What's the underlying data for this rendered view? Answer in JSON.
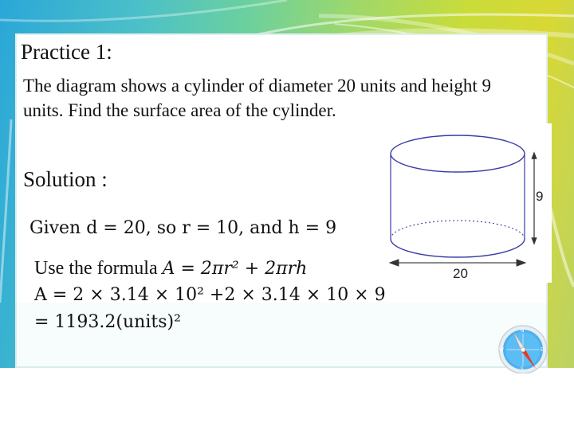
{
  "slide": {
    "title": "Practice 1:",
    "problem": "The diagram shows a cylinder of diameter 20 units and height 9 units. Find the surface area of the cylinder.",
    "solution_label": "Solution :",
    "steps": {
      "given": "Given d = 20, so r = 10, and h = 9",
      "formula_label": "Use the formula ",
      "formula": "A = 2πr² + 2πrh",
      "substitution": "A = 2 × 3.14 × 10² +2 × 3.14 × 10 × 9",
      "result": "= 1193.2(units)²"
    }
  },
  "diagram": {
    "shape": "cylinder",
    "height_label": "9",
    "diameter_label": "20",
    "outline_color": "#3b3ba8"
  },
  "decoration": {
    "icon": "compass-icon",
    "compass_letters": [
      "N",
      "E",
      "S",
      "W"
    ]
  }
}
